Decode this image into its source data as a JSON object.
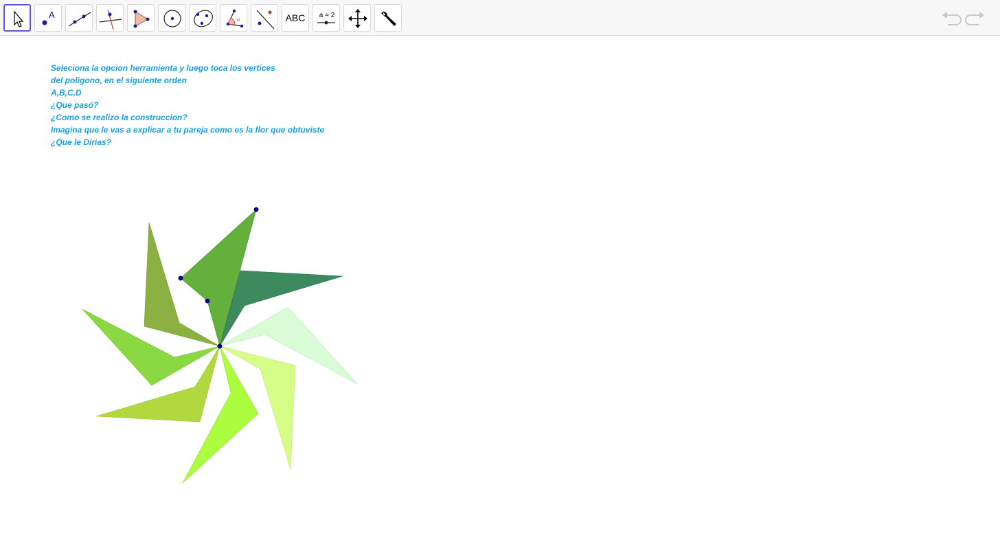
{
  "toolbar": {
    "tools": [
      {
        "name": "move-tool",
        "icon": "arrow-pointer-icon",
        "active": true
      },
      {
        "name": "point-tool",
        "icon": "point-icon"
      },
      {
        "name": "line-tool",
        "icon": "line-icon"
      },
      {
        "name": "perpendicular-line-tool",
        "icon": "perpendicular-line-icon"
      },
      {
        "name": "polygon-tool",
        "icon": "polygon-icon"
      },
      {
        "name": "circle-tool",
        "icon": "circle-icon"
      },
      {
        "name": "conic-tool",
        "icon": "conic-icon"
      },
      {
        "name": "angle-tool",
        "icon": "angle-icon"
      },
      {
        "name": "reflect-tool",
        "icon": "reflect-icon"
      },
      {
        "name": "text-tool",
        "icon": "text-icon",
        "label": "ABC"
      },
      {
        "name": "slider-tool",
        "icon": "slider-icon",
        "label": "a = 2"
      },
      {
        "name": "move-graphics-view-tool",
        "icon": "move-graphics-view-icon"
      },
      {
        "name": "general-tools",
        "icon": "wrench-icon"
      }
    ],
    "undo_icon": "undo-icon",
    "redo_icon": "redo-icon"
  },
  "instructions": [
    "Seleciona la opcion herramienta y luego toca los vertices",
    "del poligono, en el siguiente orden",
    "A,B,C,D",
    "¿Que pasó?",
    "¿Como se realizo la construccion?",
    "Imagina que le vas a explicar a tu pareja como es la flor que obtuviste",
    "¿Que le Dirias?"
  ],
  "colors": {
    "instruction_text": "#1aa0e0",
    "active_tool_border": "#6557d2",
    "point": "#0000aa",
    "petals": [
      "#64b03c",
      "#3d8a5f",
      "#d9fcd7",
      "#d6fd85",
      "#acfc3f",
      "#b1d93f",
      "#8ad943",
      "#8ab142"
    ]
  }
}
